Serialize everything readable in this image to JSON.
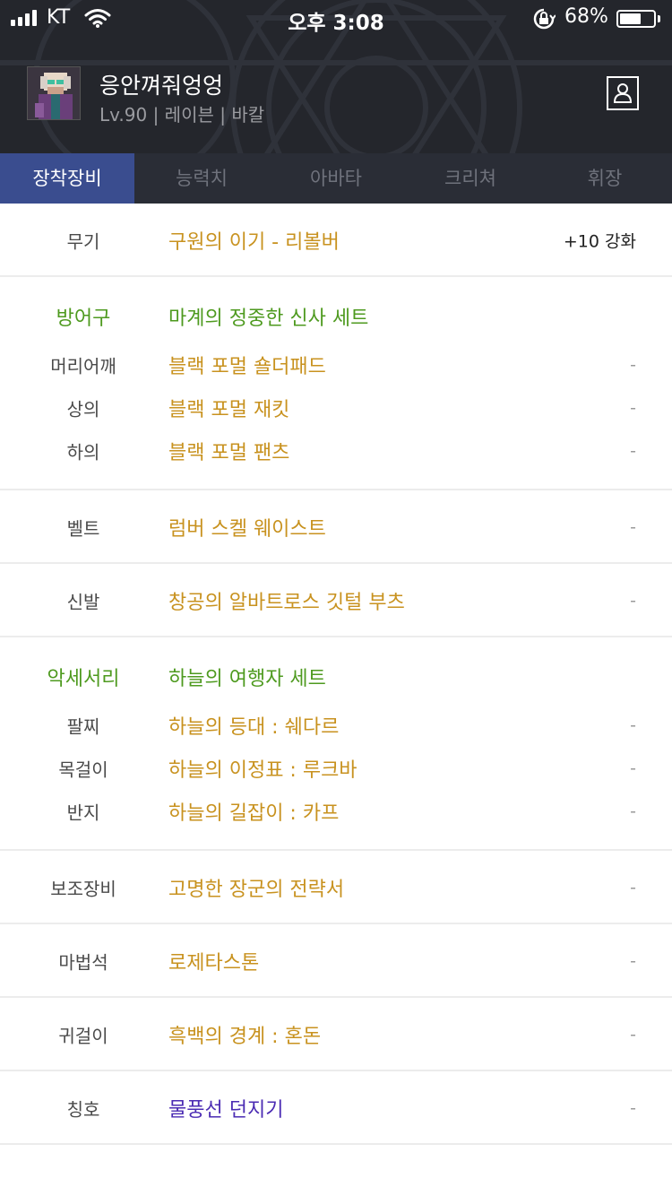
{
  "status_bar": {
    "carrier": "KT",
    "time": "오후 3:08",
    "battery_percent": "68%",
    "battery_level": 0.68
  },
  "profile": {
    "name": "응안껴줘엉엉",
    "meta": "Lv.90 | 레이븐 | 바칼"
  },
  "tabs": [
    {
      "label": "장착장비",
      "active": true
    },
    {
      "label": "능력치",
      "active": false
    },
    {
      "label": "아바타",
      "active": false
    },
    {
      "label": "크리쳐",
      "active": false
    },
    {
      "label": "휘장",
      "active": false
    }
  ],
  "equipment": {
    "weapon": {
      "category": "무기",
      "item": "구원의 이기 - 리볼버",
      "extra": "+10 강화"
    },
    "armor_set": {
      "category": "방어구",
      "item": "마계의 정중한 신사 세트"
    },
    "shoulder": {
      "category": "머리어깨",
      "item": "블랙 포멀 숄더패드",
      "extra": "-"
    },
    "top": {
      "category": "상의",
      "item": "블랙 포멀 재킷",
      "extra": "-"
    },
    "bottom": {
      "category": "하의",
      "item": "블랙 포멀 팬츠",
      "extra": "-"
    },
    "belt": {
      "category": "벨트",
      "item": "럼버 스켈 웨이스트",
      "extra": "-"
    },
    "shoes": {
      "category": "신발",
      "item": "창공의 알바트로스 깃털 부츠",
      "extra": "-"
    },
    "accessory_set": {
      "category": "악세서리",
      "item": "하늘의 여행자 세트"
    },
    "bracelet": {
      "category": "팔찌",
      "item": "하늘의 등대 : 쉐다르",
      "extra": "-"
    },
    "necklace": {
      "category": "목걸이",
      "item": "하늘의 이정표 : 루크바",
      "extra": "-"
    },
    "ring": {
      "category": "반지",
      "item": "하늘의 길잡이 : 카프",
      "extra": "-"
    },
    "sub": {
      "category": "보조장비",
      "item": "고명한 장군의 전략서",
      "extra": "-"
    },
    "magicstone": {
      "category": "마법석",
      "item": "로제타스톤",
      "extra": "-"
    },
    "earring": {
      "category": "귀걸이",
      "item": "흑백의 경계 : 혼돈",
      "extra": "-"
    },
    "title": {
      "category": "칭호",
      "item": "물풍선 던지기",
      "extra": "-"
    }
  },
  "colors": {
    "header_bg": "#24262c",
    "tab_bar_bg": "#2a2d36",
    "tab_active_bg": "#3a4d8f",
    "item_gold": "#c8921f",
    "set_green": "#4e9a1f",
    "title_purple": "#4b2bb3"
  },
  "icons": {
    "signal": "signal-bars-icon",
    "wifi": "wifi-icon",
    "rotation_lock": "rotation-lock-icon",
    "battery": "battery-icon",
    "profile": "person-card-icon"
  }
}
